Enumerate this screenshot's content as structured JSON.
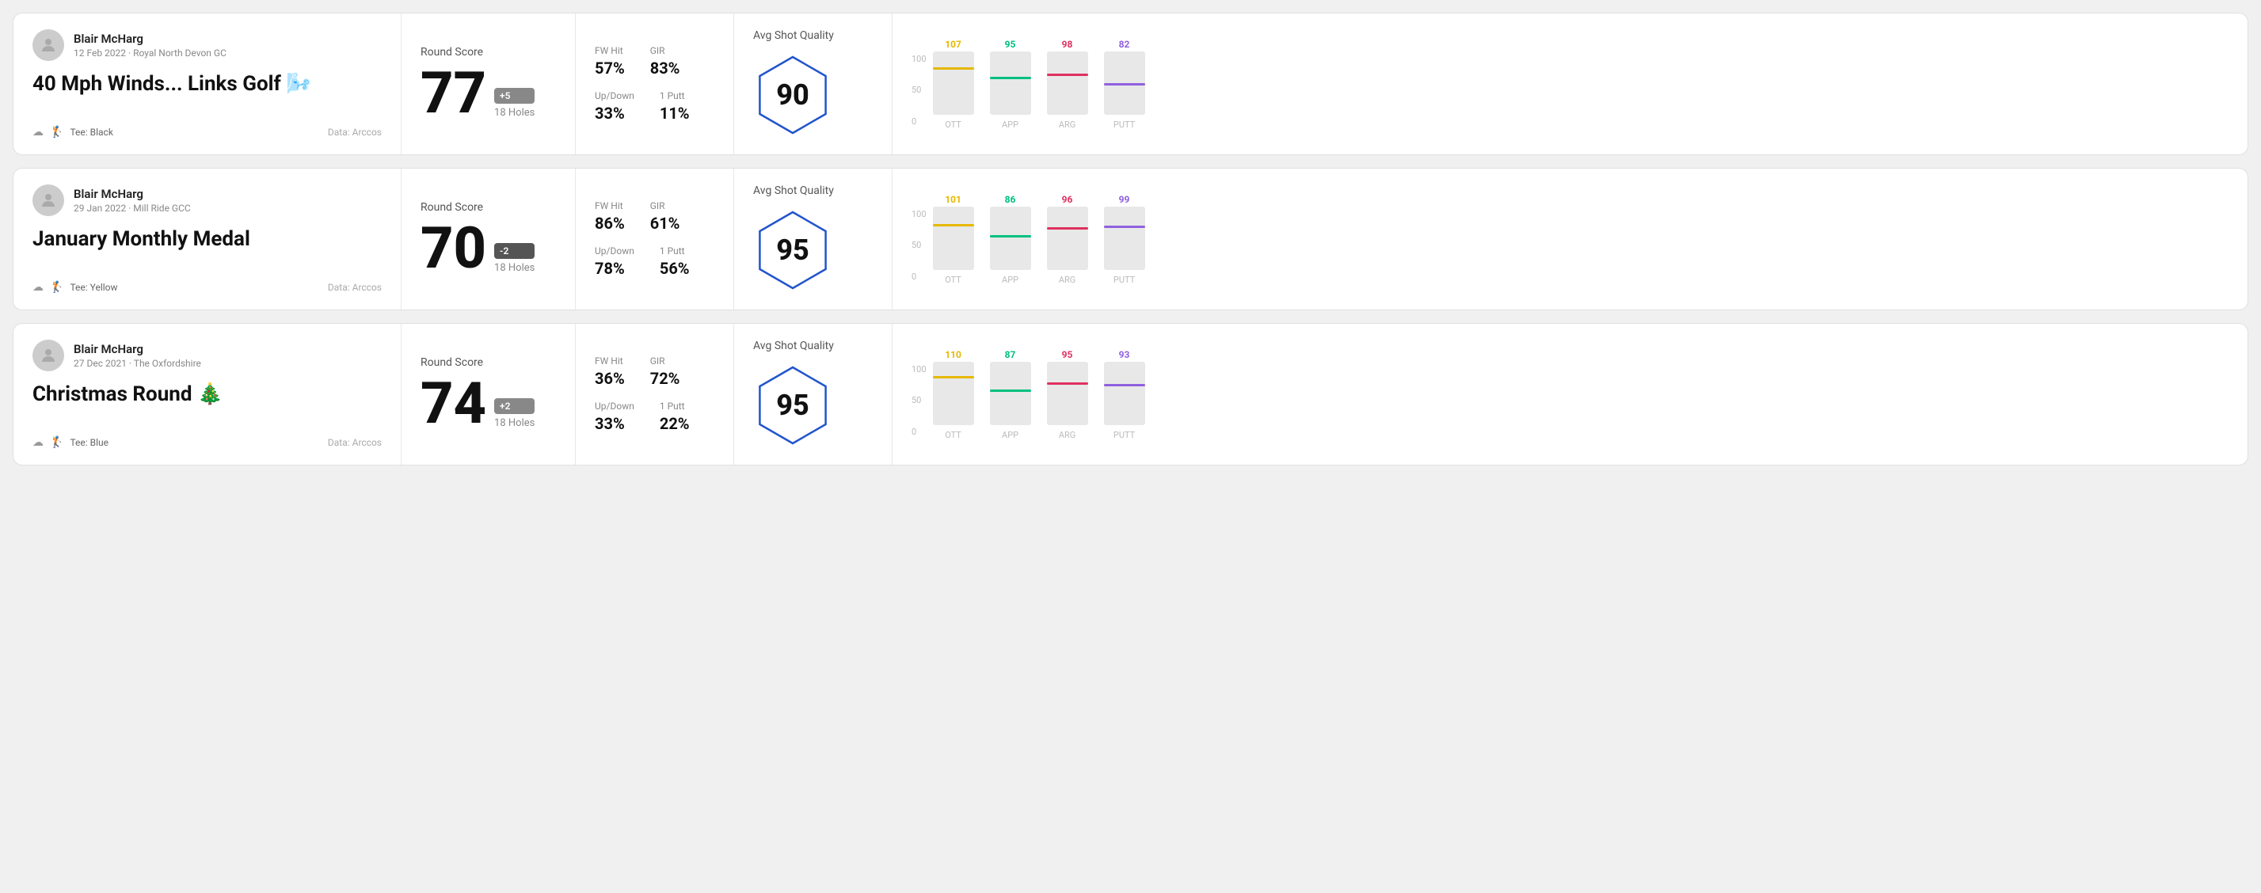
{
  "rounds": [
    {
      "id": "round1",
      "user": {
        "name": "Blair McHarg",
        "date_course": "12 Feb 2022 · Royal North Devon GC"
      },
      "title": "40 Mph Winds... Links Golf 🌬️",
      "tee": "Black",
      "data_source": "Data: Arccos",
      "score": {
        "label": "Round Score",
        "value": "77",
        "badge": "+5",
        "holes": "18 Holes"
      },
      "stats": {
        "fw_hit_label": "FW Hit",
        "fw_hit_value": "57%",
        "gir_label": "GIR",
        "gir_value": "83%",
        "updown_label": "Up/Down",
        "updown_value": "33%",
        "oneputt_label": "1 Putt",
        "oneputt_value": "11%"
      },
      "quality": {
        "label": "Avg Shot Quality",
        "score": "90"
      },
      "chart": {
        "bars": [
          {
            "label": "OTT",
            "value": 107,
            "color": "#e6b800",
            "percent": 75
          },
          {
            "label": "APP",
            "value": 95,
            "color": "#00c080",
            "percent": 60
          },
          {
            "label": "ARG",
            "value": 98,
            "color": "#e03060",
            "percent": 65
          },
          {
            "label": "PUTT",
            "value": 82,
            "color": "#9060e0",
            "percent": 50
          }
        ],
        "y_labels": [
          "100",
          "50",
          "0"
        ]
      }
    },
    {
      "id": "round2",
      "user": {
        "name": "Blair McHarg",
        "date_course": "29 Jan 2022 · Mill Ride GCC"
      },
      "title": "January Monthly Medal",
      "tee": "Yellow",
      "data_source": "Data: Arccos",
      "score": {
        "label": "Round Score",
        "value": "70",
        "badge": "-2",
        "holes": "18 Holes"
      },
      "stats": {
        "fw_hit_label": "FW Hit",
        "fw_hit_value": "86%",
        "gir_label": "GIR",
        "gir_value": "61%",
        "updown_label": "Up/Down",
        "updown_value": "78%",
        "oneputt_label": "1 Putt",
        "oneputt_value": "56%"
      },
      "quality": {
        "label": "Avg Shot Quality",
        "score": "95"
      },
      "chart": {
        "bars": [
          {
            "label": "OTT",
            "value": 101,
            "color": "#e6b800",
            "percent": 72
          },
          {
            "label": "APP",
            "value": 86,
            "color": "#00c080",
            "percent": 55
          },
          {
            "label": "ARG",
            "value": 96,
            "color": "#e03060",
            "percent": 68
          },
          {
            "label": "PUTT",
            "value": 99,
            "color": "#9060e0",
            "percent": 70
          }
        ],
        "y_labels": [
          "100",
          "50",
          "0"
        ]
      }
    },
    {
      "id": "round3",
      "user": {
        "name": "Blair McHarg",
        "date_course": "27 Dec 2021 · The Oxfordshire"
      },
      "title": "Christmas Round 🎄",
      "tee": "Blue",
      "data_source": "Data: Arccos",
      "score": {
        "label": "Round Score",
        "value": "74",
        "badge": "+2",
        "holes": "18 Holes"
      },
      "stats": {
        "fw_hit_label": "FW Hit",
        "fw_hit_value": "36%",
        "gir_label": "GIR",
        "gir_value": "72%",
        "updown_label": "Up/Down",
        "updown_value": "33%",
        "oneputt_label": "1 Putt",
        "oneputt_value": "22%"
      },
      "quality": {
        "label": "Avg Shot Quality",
        "score": "95"
      },
      "chart": {
        "bars": [
          {
            "label": "OTT",
            "value": 110,
            "color": "#e6b800",
            "percent": 78
          },
          {
            "label": "APP",
            "value": 87,
            "color": "#00c080",
            "percent": 56
          },
          {
            "label": "ARG",
            "value": 95,
            "color": "#e03060",
            "percent": 67
          },
          {
            "label": "PUTT",
            "value": 93,
            "color": "#9060e0",
            "percent": 65
          }
        ],
        "y_labels": [
          "100",
          "50",
          "0"
        ]
      }
    }
  ]
}
